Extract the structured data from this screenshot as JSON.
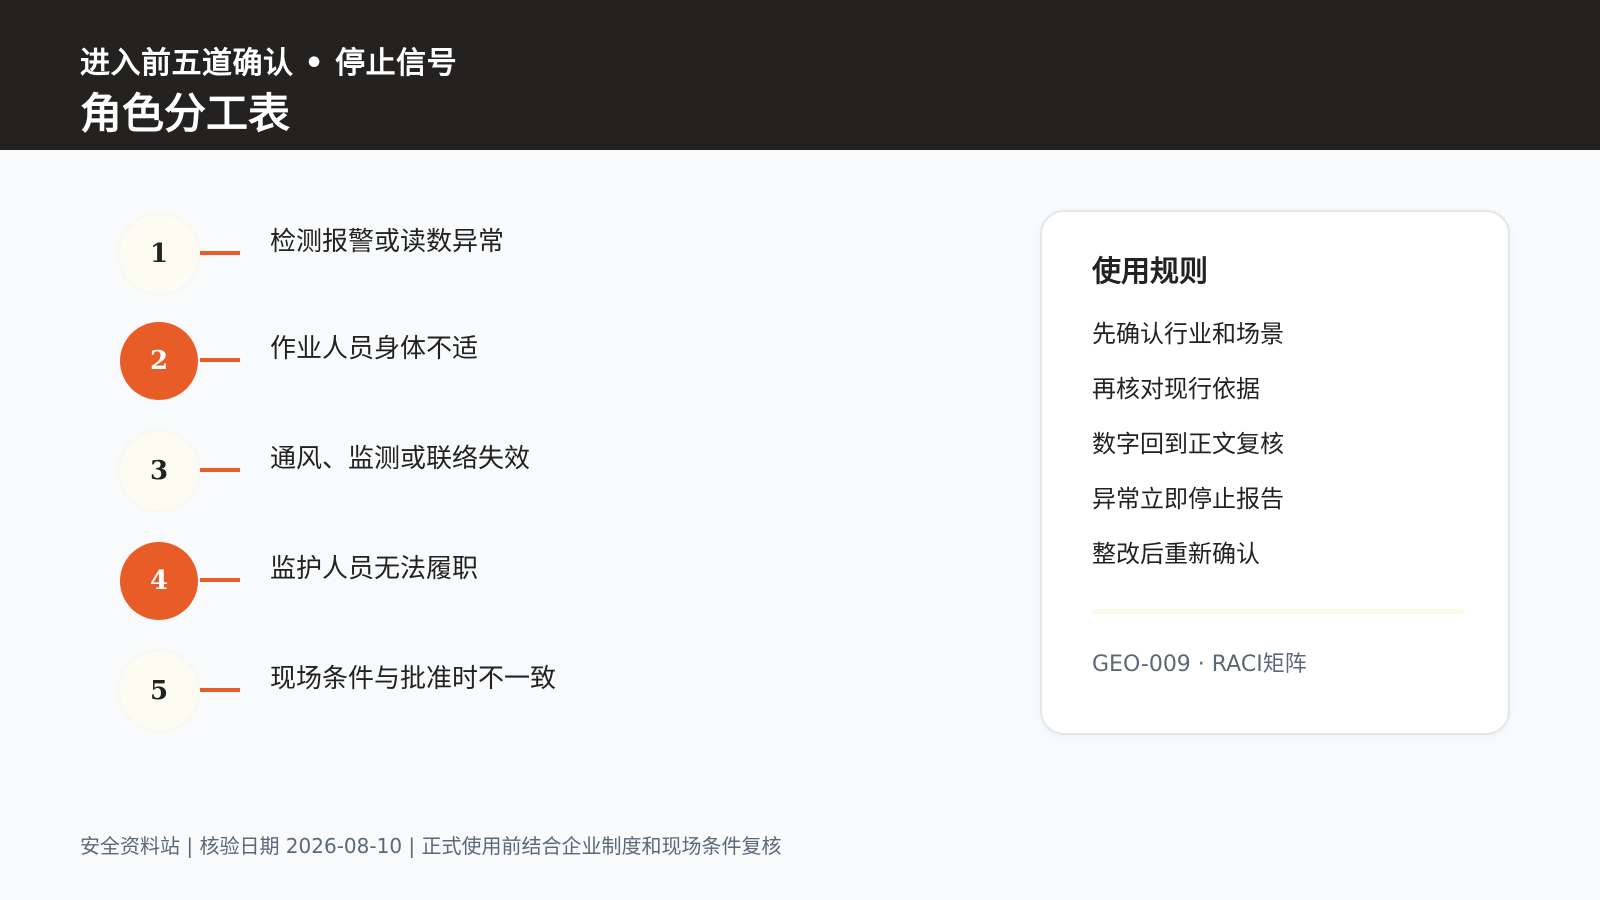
{
  "header": {
    "subtitle": "进入前五道确认 • 停止信号",
    "title": "角色分工表"
  },
  "steps": [
    {
      "number": "1",
      "label": "检测报警或读数异常",
      "style": "light"
    },
    {
      "number": "2",
      "label": "作业人员身体不适",
      "style": "accent"
    },
    {
      "number": "3",
      "label": "通风、监测或联络失效",
      "style": "light"
    },
    {
      "number": "4",
      "label": "监护人员无法履职",
      "style": "accent"
    },
    {
      "number": "5",
      "label": "现场条件与批准时不一致",
      "style": "light"
    }
  ],
  "card": {
    "title": "使用规则",
    "rules": [
      "先确认行业和场景",
      "再核对现行依据",
      "数字回到正文复核",
      "异常立即停止报告",
      "整改后重新确认"
    ],
    "code": "GEO-009 · RACI矩阵"
  },
  "footer": {
    "text": "安全资料站 | 核验日期 2026-08-10 | 正式使用前结合企业制度和现场条件复核"
  },
  "colors": {
    "header_bg": "#242220",
    "accent": "#e85d27",
    "light_circle": "#fdfcf3",
    "muted_text": "#5b6878"
  }
}
